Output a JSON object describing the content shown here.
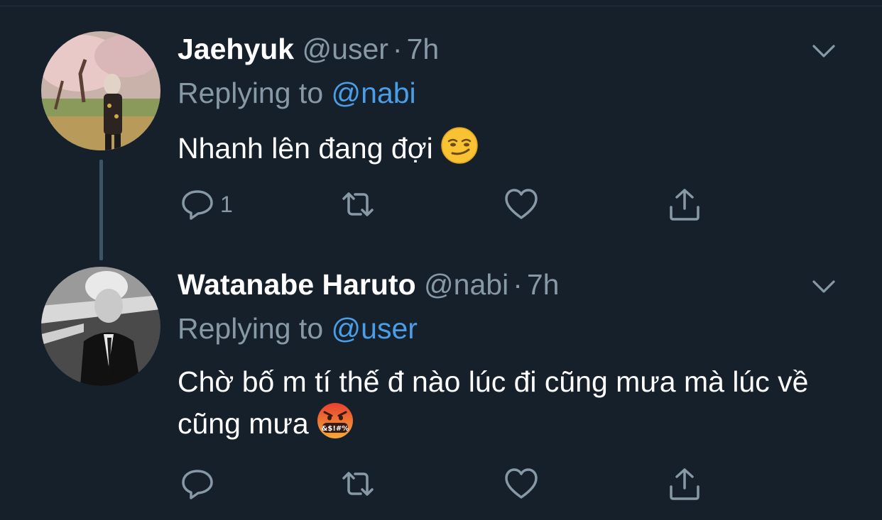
{
  "tweets": [
    {
      "name": "Jaehyuk",
      "handle": "@user",
      "separator": "·",
      "time": "7h",
      "replying_prefix": "Replying to",
      "replying_to": "@nabi",
      "text": "Nhanh lên đang đợi",
      "emoji_icon": "smirking-face-emoji",
      "reply_count": "1"
    },
    {
      "name": "Watanabe Haruto",
      "handle": "@nabi",
      "separator": "·",
      "time": "7h",
      "replying_prefix": "Replying to",
      "replying_to": "@user",
      "text": "Chờ bố m tí thế đ nào lúc đi cũng mưa mà lúc về cũng mưa",
      "emoji_icon": "face-with-symbols-on-mouth-emoji",
      "reply_count": ""
    }
  ],
  "icons": {
    "reply": "reply-icon",
    "retweet": "retweet-icon",
    "like": "like-icon",
    "share": "share-icon",
    "caret": "chevron-down-icon"
  },
  "colors": {
    "background": "#15202b",
    "muted_text": "#8899a6",
    "mention": "#4a9ee8",
    "thread_line": "#3d5466"
  }
}
